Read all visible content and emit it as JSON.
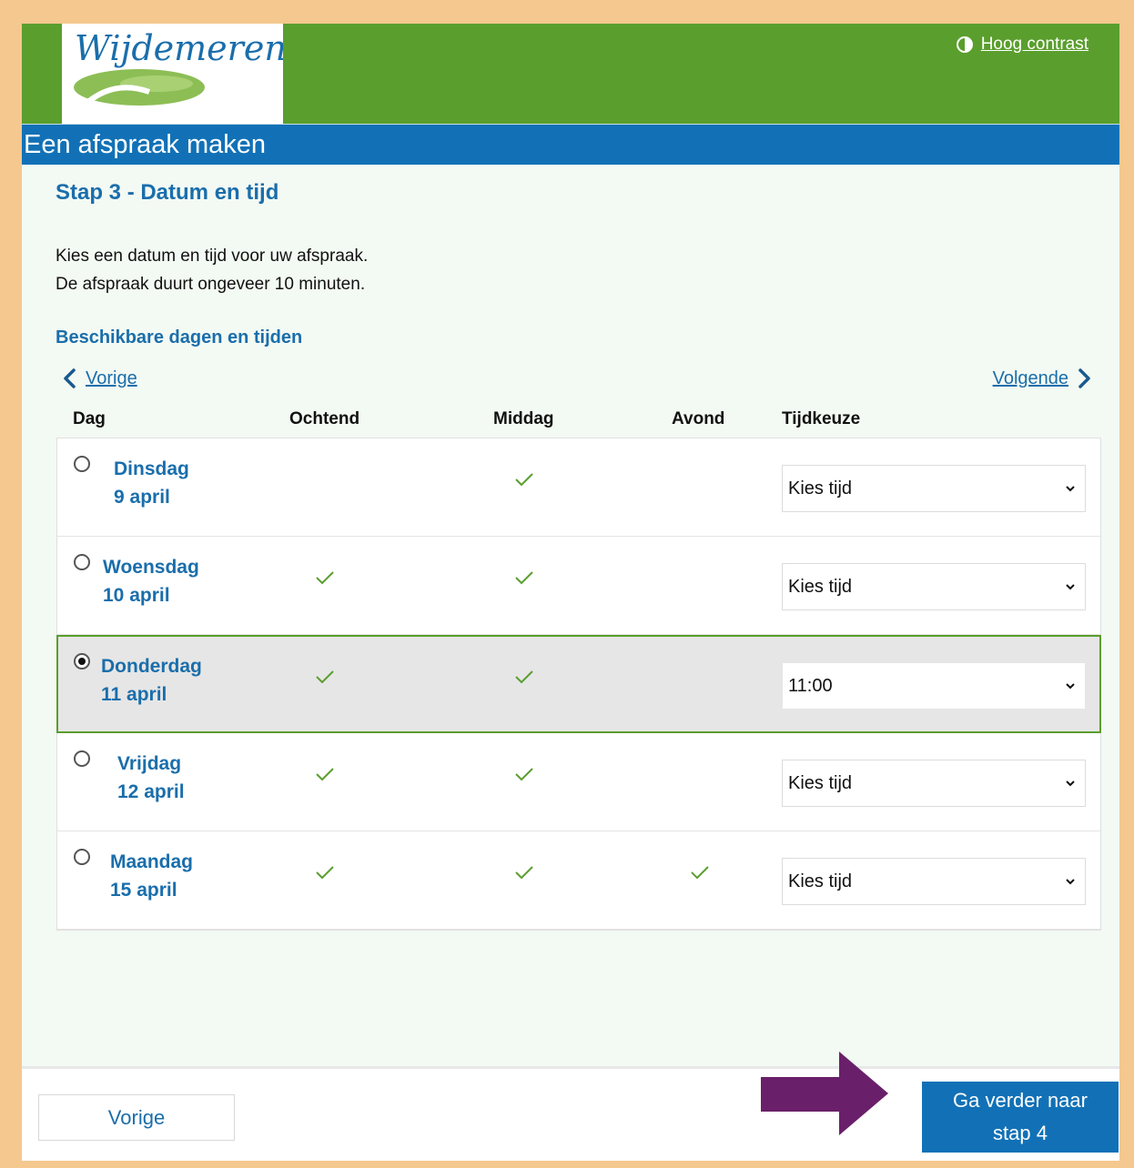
{
  "header": {
    "logo_text": "Wijdemeren",
    "contrast_label": "Hoog contrast"
  },
  "page_title": "Een afspraak maken",
  "step_title": "Stap 3 - Datum en tijd",
  "intro": {
    "line1": "Kies een datum en tijd voor uw afspraak.",
    "line2": "De afspraak duurt ongeveer 10 minuten."
  },
  "section_title": "Beschikbare dagen en tijden",
  "nav": {
    "prev": "Vorige",
    "next": "Volgende"
  },
  "columns": {
    "day": "Dag",
    "morning": "Ochtend",
    "afternoon": "Middag",
    "evening": "Avond",
    "time": "Tijdkeuze"
  },
  "rows": [
    {
      "day": "Dinsdag",
      "date": "9 april",
      "morning": false,
      "afternoon": true,
      "evening": false,
      "time": "Kies tijd",
      "selected": false
    },
    {
      "day": "Woensdag",
      "date": "10 april",
      "morning": true,
      "afternoon": true,
      "evening": false,
      "time": "Kies tijd",
      "selected": false
    },
    {
      "day": "Donderdag",
      "date": "11 april",
      "morning": true,
      "afternoon": true,
      "evening": false,
      "time": "11:00",
      "selected": true
    },
    {
      "day": "Vrijdag",
      "date": "12 april",
      "morning": true,
      "afternoon": true,
      "evening": false,
      "time": "Kies tijd",
      "selected": false
    },
    {
      "day": "Maandag",
      "date": "15 april",
      "morning": true,
      "afternoon": true,
      "evening": true,
      "time": "Kies tijd",
      "selected": false
    }
  ],
  "footer": {
    "prev_button": "Vorige",
    "next_button_line1": "Ga verder naar",
    "next_button_line2": "stap 4"
  },
  "colors": {
    "green": "#5a9e2d",
    "blue": "#1271b6",
    "annotation_arrow": "#6a1f6a"
  }
}
